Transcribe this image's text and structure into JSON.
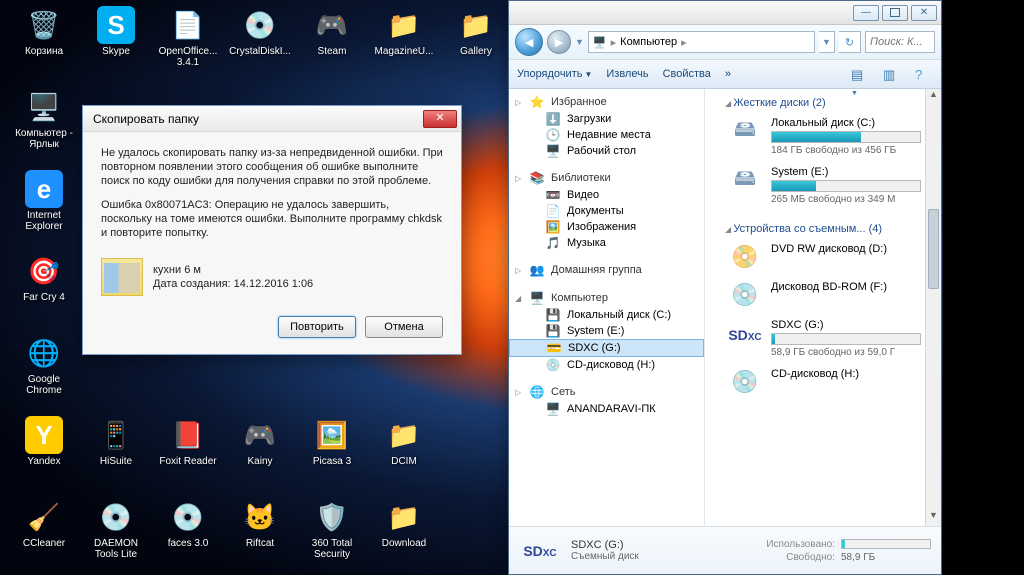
{
  "desktop_icons": [
    {
      "label": "Корзина",
      "glyph": "🗑️"
    },
    {
      "label": "Skype",
      "glyph": "S",
      "color": "#00aff0"
    },
    {
      "label": "OpenOffice... 3.4.1",
      "glyph": "📄"
    },
    {
      "label": "CrystalDiskI...",
      "glyph": "💿"
    },
    {
      "label": "Steam",
      "glyph": "🎮"
    },
    {
      "label": "MagazineU...",
      "glyph": "📁"
    },
    {
      "label": "Gallery",
      "glyph": "📁"
    },
    {
      "label": "Компьютер - Ярлык",
      "glyph": "🖥️"
    },
    {
      "label": "",
      "glyph": ""
    },
    {
      "label": "",
      "glyph": ""
    },
    {
      "label": "",
      "glyph": ""
    },
    {
      "label": "",
      "glyph": ""
    },
    {
      "label": "",
      "glyph": ""
    },
    {
      "label": "",
      "glyph": ""
    },
    {
      "label": "Internet Explorer",
      "glyph": "e",
      "color": "#1e90ff"
    },
    {
      "label": "",
      "glyph": ""
    },
    {
      "label": "",
      "glyph": ""
    },
    {
      "label": "",
      "glyph": ""
    },
    {
      "label": "",
      "glyph": ""
    },
    {
      "label": "",
      "glyph": ""
    },
    {
      "label": "",
      "glyph": ""
    },
    {
      "label": "Far Cry 4",
      "glyph": "🎯"
    },
    {
      "label": "",
      "glyph": ""
    },
    {
      "label": "",
      "glyph": ""
    },
    {
      "label": "",
      "glyph": ""
    },
    {
      "label": "",
      "glyph": ""
    },
    {
      "label": "",
      "glyph": ""
    },
    {
      "label": "",
      "glyph": ""
    },
    {
      "label": "Google Chrome",
      "glyph": "🌐"
    },
    {
      "label": "",
      "glyph": ""
    },
    {
      "label": "",
      "glyph": ""
    },
    {
      "label": "",
      "glyph": ""
    },
    {
      "label": "",
      "glyph": ""
    },
    {
      "label": "",
      "glyph": ""
    },
    {
      "label": "",
      "glyph": ""
    },
    {
      "label": "Yandex",
      "glyph": "Y",
      "color": "#ffcc00"
    },
    {
      "label": "HiSuite",
      "glyph": "📱"
    },
    {
      "label": "Foxit Reader",
      "glyph": "📕"
    },
    {
      "label": "Kainy",
      "glyph": "🎮"
    },
    {
      "label": "Picasa 3",
      "glyph": "🖼️"
    },
    {
      "label": "DCIM",
      "glyph": "📁"
    },
    {
      "label": "",
      "glyph": ""
    },
    {
      "label": "CCleaner",
      "glyph": "🧹"
    },
    {
      "label": "DAEMON Tools Lite",
      "glyph": "💿"
    },
    {
      "label": "faces 3.0",
      "glyph": "💿"
    },
    {
      "label": "Riftcat",
      "glyph": "🐱"
    },
    {
      "label": "360 Total Security",
      "glyph": "🛡️"
    },
    {
      "label": "Download",
      "glyph": "📁"
    }
  ],
  "dialog": {
    "title": "Скопировать папку",
    "p1": "Не удалось скопировать папку из-за непредвиденной ошибки. При повторном появлении этого сообщения об ошибке выполните поиск по коду ошибки для получения справки по этой проблеме.",
    "p2": "Ошибка 0x80071AC3: Операцию не удалось завершить, поскольку на томе имеются ошибки. Выполните программу chkdsk и повторите попытку.",
    "file_name": "кухни 6 м",
    "file_date": "Дата создания: 14.12.2016 1:06",
    "btn_retry": "Повторить",
    "btn_cancel": "Отмена"
  },
  "explorer": {
    "breadcrumb_root": "Компьютер",
    "search_placeholder": "Поиск: К...",
    "toolbar": {
      "organize": "Упорядочить",
      "extract": "Извлечь",
      "properties": "Свойства"
    },
    "sidebar": {
      "favorites": "Избранное",
      "favorites_items": [
        "Загрузки",
        "Недавние места",
        "Рабочий стол"
      ],
      "libraries": "Библиотеки",
      "libraries_items": [
        "Видео",
        "Документы",
        "Изображения",
        "Музыка"
      ],
      "homegroup": "Домашняя группа",
      "computer": "Компьютер",
      "computer_items": [
        "Локальный диск (C:)",
        "System (E:)",
        "SDXC (G:)",
        "CD-дисковод (H:)"
      ],
      "network": "Сеть",
      "network_items": [
        "ANANDARAVI-ПК"
      ]
    },
    "content": {
      "hdd_header": "Жесткие диски (2)",
      "removable_header": "Устройства со съемным... (4)",
      "drives": [
        {
          "name": "Локальный диск (C:)",
          "free": "184 ГБ свободно из 456 ГБ",
          "pct": 60,
          "icon": "hdd"
        },
        {
          "name": "System (E:)",
          "free": "265 МБ свободно из 349 М",
          "pct": 30,
          "icon": "hdd"
        }
      ],
      "removable": [
        {
          "name": "DVD RW дисковод (D:)",
          "icon": "dvd"
        },
        {
          "name": "Дисковод BD-ROM (F:)",
          "icon": "bd"
        },
        {
          "name": "SDXC (G:)",
          "free": "58,9 ГБ свободно из 59,0 Г",
          "pct": 2,
          "icon": "sdxc"
        },
        {
          "name": "CD-дисковод (H:)",
          "icon": "cd"
        }
      ]
    },
    "details": {
      "title": "SDXC (G:)",
      "subtitle": "Съемный диск",
      "used_label": "Использовано:",
      "free_label": "Свободно:",
      "free_val": "58,9 ГБ"
    }
  }
}
